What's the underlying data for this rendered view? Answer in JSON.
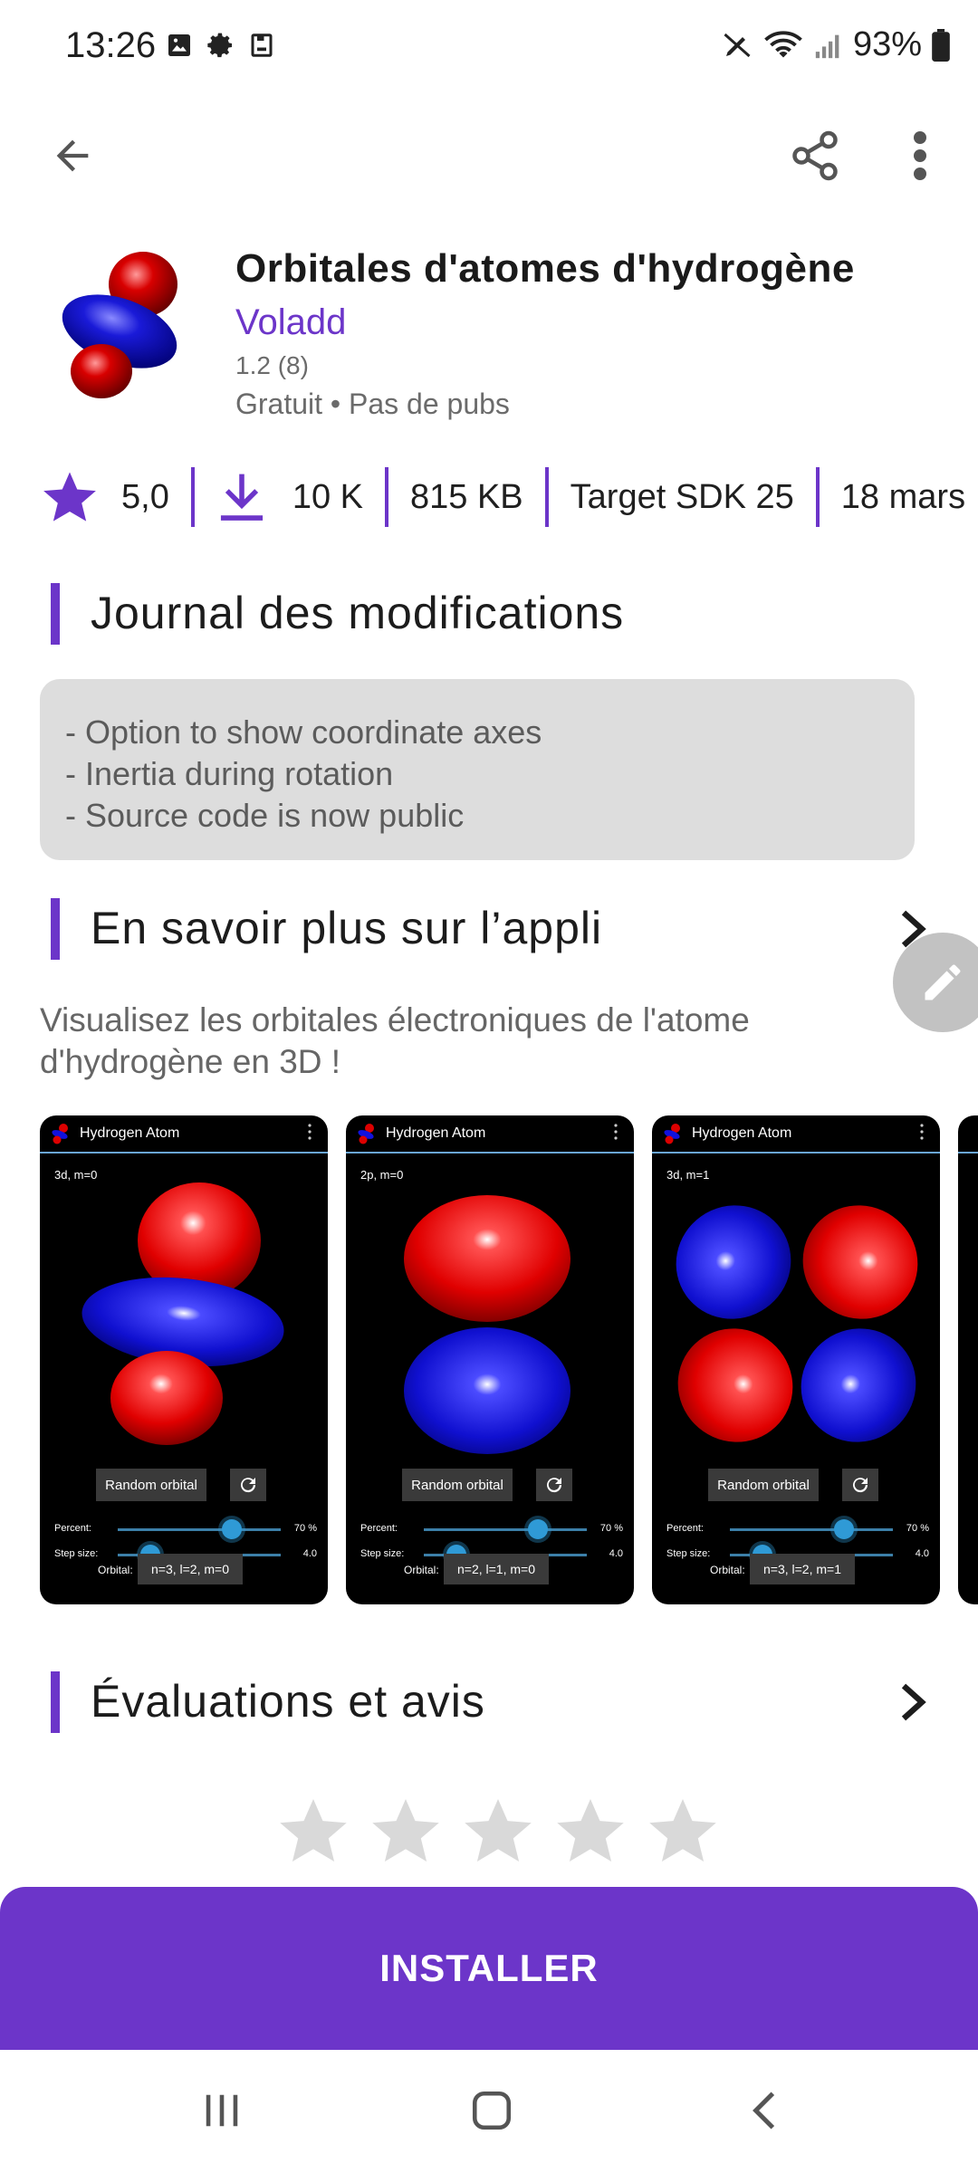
{
  "status": {
    "time": "13:26",
    "battery": "93%"
  },
  "app": {
    "title": "Orbitales d'atomes d'hydrogène",
    "developer": "Voladd",
    "version": "1.2 (8)",
    "price": "Gratuit • Pas de pubs"
  },
  "stats": {
    "rating": "5,0",
    "downloads": "10 K",
    "size": "815 KB",
    "target_sdk": "Target SDK 25",
    "date": "18 mars"
  },
  "changelog": {
    "title": "Journal des modifications",
    "lines": [
      "- Option to show coordinate axes",
      "- Inertia during rotation",
      "- Source code is now public"
    ]
  },
  "about": {
    "title": "En savoir plus sur l’appli",
    "description": "Visualisez les orbitales électroniques de l'atome d'hydrogène en 3D !"
  },
  "screenshots": [
    {
      "title": "Hydrogen Atom",
      "label": "3d, m=0",
      "button": "Random orbital",
      "percent_label": "Percent:",
      "percent_value": "70 %",
      "percent": 0.7,
      "step_label": "Step size:",
      "step_value": "4.0",
      "step": 0.2,
      "orbital_label": "Orbital:",
      "orbital_value": "n=3, l=2, m=0"
    },
    {
      "title": "Hydrogen Atom",
      "label": "2p, m=0",
      "button": "Random orbital",
      "percent_label": "Percent:",
      "percent_value": "70 %",
      "percent": 0.7,
      "step_label": "Step size:",
      "step_value": "4.0",
      "step": 0.2,
      "orbital_label": "Orbital:",
      "orbital_value": "n=2, l=1, m=0"
    },
    {
      "title": "Hydrogen Atom",
      "label": "3d, m=1",
      "button": "Random orbital",
      "percent_label": "Percent:",
      "percent_value": "70 %",
      "percent": 0.7,
      "step_label": "Step size:",
      "step_value": "4.0",
      "step": 0.2,
      "orbital_label": "Orbital:",
      "orbital_value": "n=3, l=2, m=1"
    }
  ],
  "reviews": {
    "title": "Évaluations et avis",
    "star_count": 5
  },
  "install": {
    "label": "INSTALLER"
  },
  "colors": {
    "accent": "#6c35c9",
    "orbital_red": "#e00000",
    "orbital_blue": "#1010d0"
  }
}
